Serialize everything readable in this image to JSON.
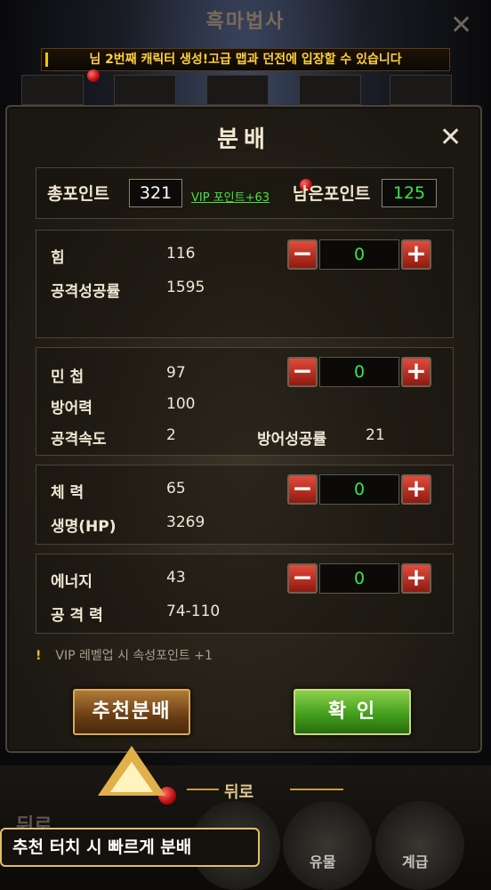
{
  "header": {
    "title": "흑마법사",
    "banner": "님 2번째 캐릭터 생성!고급 맵과 던전에 입장할 수 있습니다"
  },
  "dialog": {
    "title": "분배",
    "total_points_label": "총포인트",
    "total_points": "321",
    "vip_bonus": "VIP 포인트+63",
    "remaining_label": "남은포인트",
    "remaining_points": "125",
    "stats": [
      {
        "label": "힘",
        "value": "116",
        "alloc": "0",
        "details": [
          {
            "label": "공격성공률",
            "value": "1595"
          }
        ]
      },
      {
        "label": "민 첩",
        "value": "97",
        "alloc": "0",
        "details": [
          {
            "label": "방어력",
            "value": "100"
          },
          {
            "label": "공격속도",
            "value": "2"
          }
        ],
        "extra": {
          "label": "방어성공률",
          "value": "21"
        }
      },
      {
        "label": "체 력",
        "value": "65",
        "alloc": "0",
        "details": [
          {
            "label": "생명(HP)",
            "value": "3269"
          }
        ]
      },
      {
        "label": "에너지",
        "value": "43",
        "alloc": "0",
        "details": [
          {
            "label": "공 격 력",
            "value": "74-110"
          }
        ]
      }
    ],
    "note": "VIP 레벨업 시 속성포인트 +1",
    "recommend_button": "추천분배",
    "confirm_button": "확 인"
  },
  "bottom_nav": {
    "back_label": "뒤로",
    "left_back": "뒤로",
    "items": [
      "유물",
      "계급"
    ]
  },
  "tooltip": "추천 터치 시 빠르게 분배",
  "colors": {
    "accent_green": "#37e64a",
    "banner_yellow": "#ffd23a",
    "minus_red": "#c93020"
  }
}
